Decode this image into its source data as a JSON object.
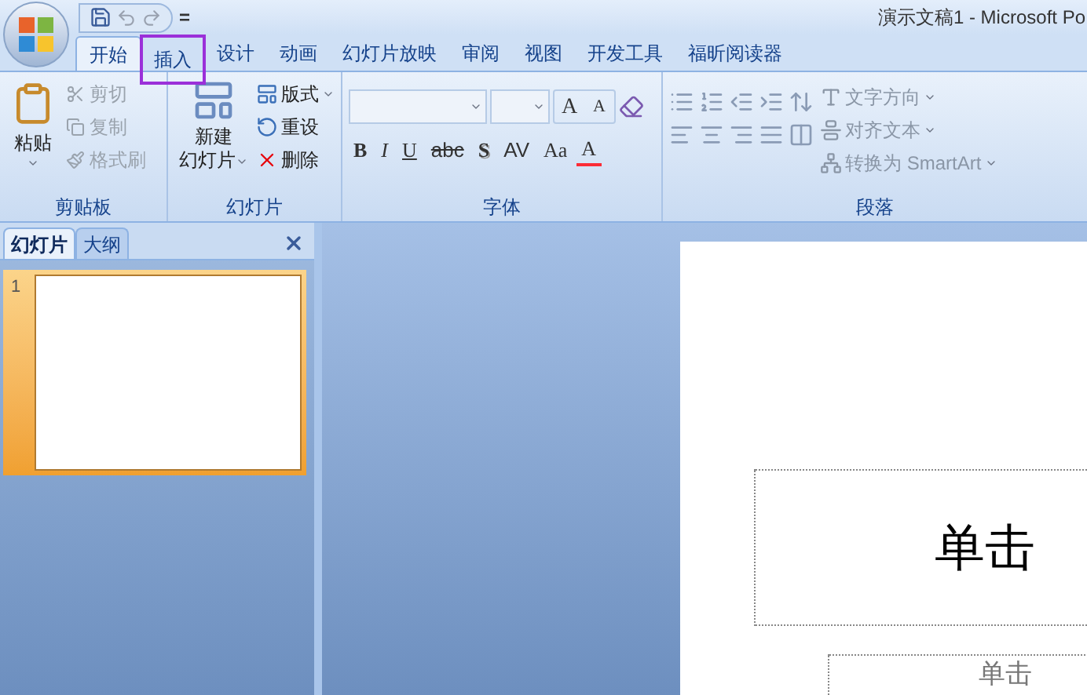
{
  "window": {
    "title": "演示文稿1 - Microsoft Po"
  },
  "quick_access": {
    "customize": "="
  },
  "tabs": [
    {
      "label": "开始",
      "selected": true,
      "highlighted": false
    },
    {
      "label": "插入",
      "selected": false,
      "highlighted": true
    },
    {
      "label": "设计",
      "selected": false,
      "highlighted": false
    },
    {
      "label": "动画",
      "selected": false,
      "highlighted": false
    },
    {
      "label": "幻灯片放映",
      "selected": false,
      "highlighted": false
    },
    {
      "label": "审阅",
      "selected": false,
      "highlighted": false
    },
    {
      "label": "视图",
      "selected": false,
      "highlighted": false
    },
    {
      "label": "开发工具",
      "selected": false,
      "highlighted": false
    },
    {
      "label": "福昕阅读器",
      "selected": false,
      "highlighted": false
    }
  ],
  "clipboard": {
    "label": "剪贴板",
    "paste": "粘贴",
    "items": [
      {
        "label": "剪切",
        "disabled": true
      },
      {
        "label": "复制",
        "disabled": true
      },
      {
        "label": "格式刷",
        "disabled": true
      }
    ]
  },
  "slides_group": {
    "label": "幻灯片",
    "new_slide": [
      "新建",
      "幻灯片"
    ],
    "items": [
      {
        "label": "版式",
        "dropdown": true
      },
      {
        "label": "重设",
        "dropdown": false
      },
      {
        "label": "删除",
        "dropdown": false
      }
    ]
  },
  "font": {
    "label": "字体",
    "size_buttons": [
      {
        "text": "A",
        "kind": "grow"
      },
      {
        "text": "A",
        "kind": "shrink"
      }
    ],
    "format_buttons": [
      {
        "text": "B",
        "kind": "bold"
      },
      {
        "text": "I",
        "kind": "italic"
      },
      {
        "text": "U",
        "kind": "underline"
      },
      {
        "text": "abc",
        "kind": "strike"
      },
      {
        "text": "S",
        "kind": "shadow"
      },
      {
        "text": "AV",
        "kind": "spacing"
      },
      {
        "text": "Aa",
        "kind": "case"
      },
      {
        "text": "A",
        "kind": "color"
      }
    ]
  },
  "paragraph": {
    "label": "段落",
    "commands": [
      {
        "label": "文字方向"
      },
      {
        "label": "对齐文本"
      },
      {
        "label": "转换为 SmartArt"
      }
    ]
  },
  "pane": {
    "tabs": [
      {
        "label": "幻灯片",
        "selected": true
      },
      {
        "label": "大纲",
        "selected": false
      }
    ],
    "thumbnails": [
      {
        "number": "1",
        "selected": true
      }
    ]
  },
  "slide": {
    "title_placeholder": "单击",
    "subtitle_placeholder": "单击"
  }
}
